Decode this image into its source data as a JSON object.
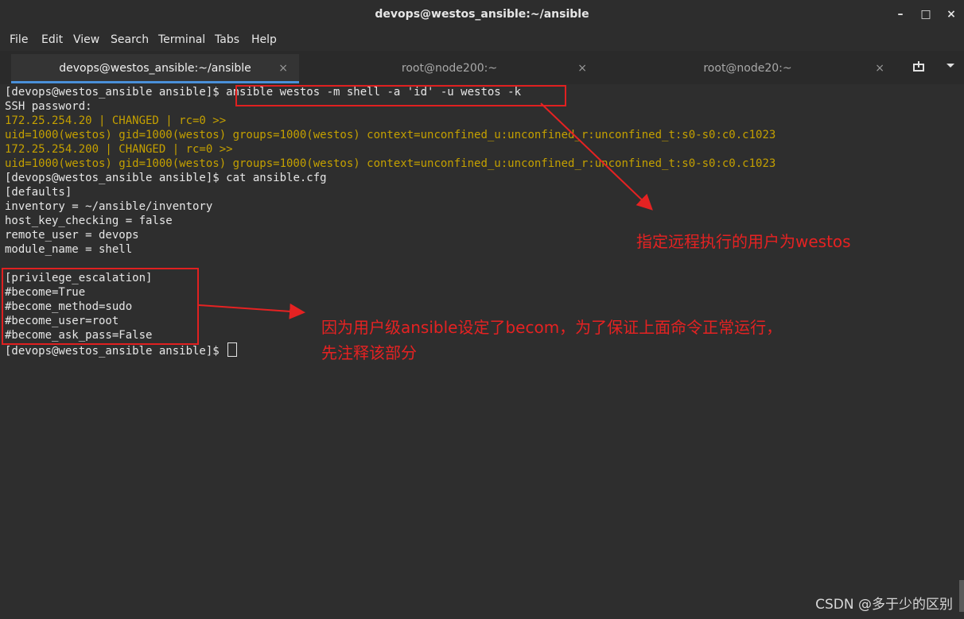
{
  "window": {
    "title": "devops@westos_ansible:~/ansible",
    "buttons": {
      "minimize": "–",
      "maximize": "□",
      "close": "×"
    }
  },
  "menu": [
    "File",
    "Edit",
    "View",
    "Search",
    "Terminal",
    "Tabs",
    "Help"
  ],
  "tabs": [
    {
      "label": "devops@westos_ansible:~/ansible",
      "close": "×",
      "active": true
    },
    {
      "label": "root@node200:~",
      "close": "×",
      "active": false
    },
    {
      "label": "root@node20:~",
      "close": "×",
      "active": false
    }
  ],
  "tab_icons": {
    "new_tab": "new-tab-icon",
    "menu": "chevron-down-icon"
  },
  "terminal": {
    "lines": [
      {
        "prompt": "[devops@westos_ansible ansible]$ ",
        "cmd": "ansible westos -m shell -a 'id' -u westos -k"
      },
      {
        "text": "SSH password:"
      },
      {
        "text": "172.25.254.20 | CHANGED | rc=0 >>",
        "color": "yellow"
      },
      {
        "text": "uid=1000(westos) gid=1000(westos) groups=1000(westos) context=unconfined_u:unconfined_r:unconfined_t:s0-s0:c0.c1023",
        "color": "yellow"
      },
      {
        "text": "172.25.254.200 | CHANGED | rc=0 >>",
        "color": "yellow"
      },
      {
        "text": "uid=1000(westos) gid=1000(westos) groups=1000(westos) context=unconfined_u:unconfined_r:unconfined_t:s0-s0:c0.c1023",
        "color": "yellow"
      },
      {
        "prompt": "[devops@westos_ansible ansible]$ ",
        "cmd": "cat ansible.cfg"
      },
      {
        "text": "[defaults]"
      },
      {
        "text": "inventory = ~/ansible/inventory"
      },
      {
        "text": "host_key_checking = false"
      },
      {
        "text": "remote_user = devops"
      },
      {
        "text": "module_name = shell"
      },
      {
        "text": ""
      },
      {
        "text": "[privilege_escalation]"
      },
      {
        "text": "#become=True"
      },
      {
        "text": "#become_method=sudo"
      },
      {
        "text": "#become_user=root"
      },
      {
        "text": "#become_ask_pass=False"
      },
      {
        "prompt": "[devops@westos_ansible ansible]$ ",
        "cmd": ""
      }
    ]
  },
  "annotations": {
    "note1": "指定远程执行的用户为westos",
    "note2_line1": "因为用户级ansible设定了becom，为了保证上面命令正常运行，",
    "note2_line2": "先注释该部分"
  },
  "colors": {
    "annotation": "#e52222",
    "output_yellow": "#c4a000",
    "tab_accent": "#4a90d9"
  },
  "watermark": "CSDN @多于少的区别"
}
